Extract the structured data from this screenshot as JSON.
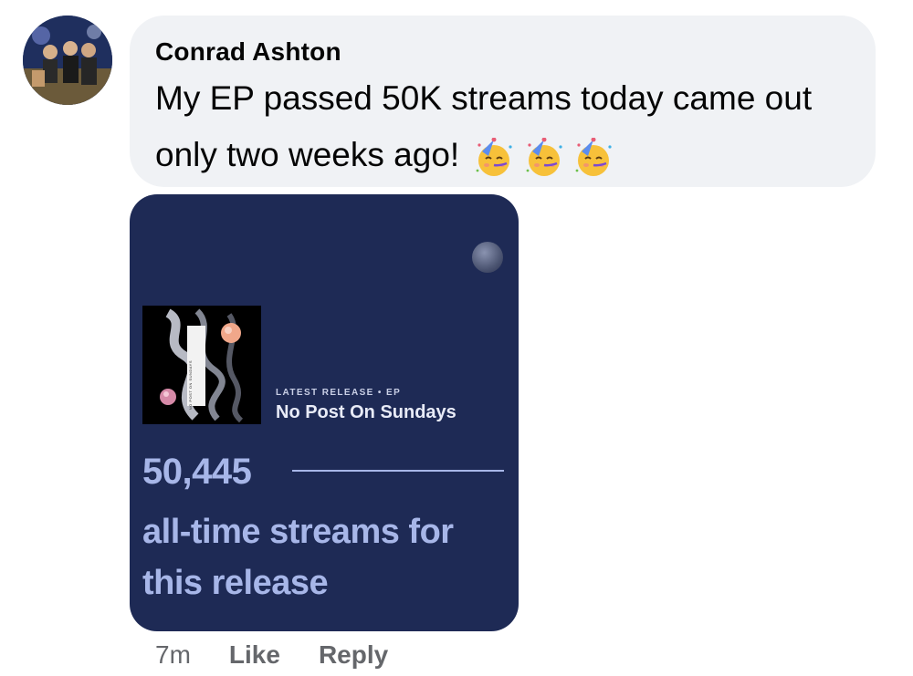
{
  "comment": {
    "author": "Conrad Ashton",
    "text_line1": "My EP passed 50K streams today came out",
    "text_line2": "only two weeks ago!",
    "emojis": [
      "partying-face-emoji",
      "partying-face-emoji",
      "partying-face-emoji"
    ]
  },
  "card": {
    "release_label": "LATEST RELEASE • EP",
    "release_title": "No Post On Sundays",
    "stream_count": "50,445",
    "stream_caption": "all-time streams for this release",
    "album_cover_text": "NO POST ON SUNDAYS"
  },
  "actions": {
    "timestamp": "7m",
    "like_label": "Like",
    "reply_label": "Reply"
  },
  "colors": {
    "bubble_bg": "#f0f2f5",
    "card_bg": "#1e2a55",
    "card_accent": "#a7b6e8",
    "action_text": "#65676b"
  }
}
